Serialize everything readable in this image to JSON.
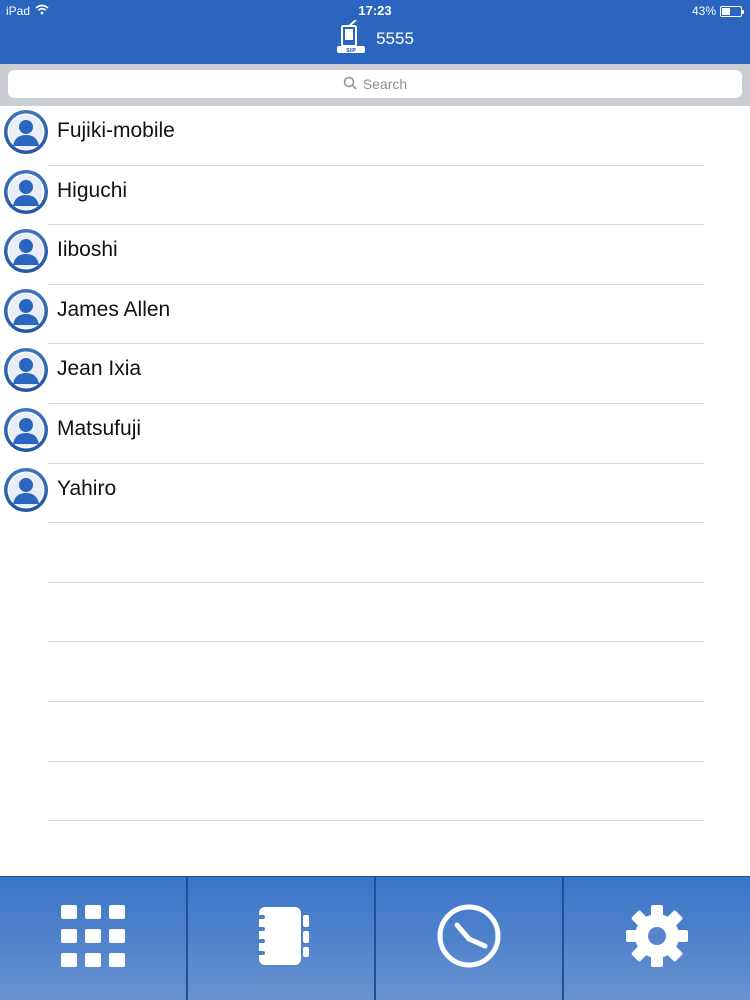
{
  "status_bar": {
    "device": "iPad",
    "time": "17:23",
    "battery": "43%",
    "battery_level": 0.43
  },
  "header": {
    "title": "5555",
    "icon": "sip-phone-icon"
  },
  "search": {
    "placeholder": "Search"
  },
  "contacts": [
    "Fujiki-mobile",
    "Higuchi",
    "Iiboshi",
    "James Allen",
    "Jean Ixia",
    "Matsufuji",
    "Yahiro"
  ],
  "tabs": [
    {
      "icon": "dialpad-icon"
    },
    {
      "icon": "contacts-book-icon"
    },
    {
      "icon": "clock-icon"
    },
    {
      "icon": "gear-icon"
    }
  ],
  "colors": {
    "header": "#2a66bf",
    "tabbar": "#4a7fc9",
    "search_bg": "#c9ccd1"
  }
}
